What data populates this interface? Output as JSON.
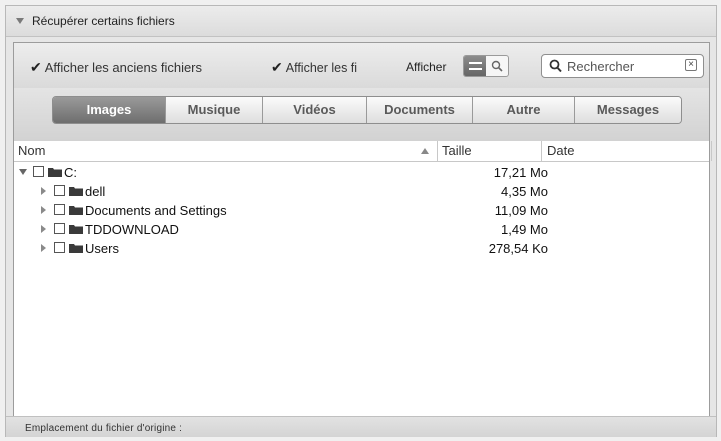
{
  "panel": {
    "title": "Récupérer certains fichiers"
  },
  "toolbar": {
    "show_old_files": {
      "label": "Afficher les anciens fichiers",
      "checked": true
    },
    "show_files_truncated": {
      "label": "Afficher les fi",
      "checked": true
    },
    "display_label": "Afficher",
    "search": {
      "placeholder": "Rechercher"
    }
  },
  "tabs": [
    {
      "label": "Images",
      "active": true
    },
    {
      "label": "Musique",
      "active": false
    },
    {
      "label": "Vidéos",
      "active": false
    },
    {
      "label": "Documents",
      "active": false
    },
    {
      "label": "Autre",
      "active": false
    },
    {
      "label": "Messages",
      "active": false
    }
  ],
  "columns": {
    "name": "Nom",
    "size": "Taille",
    "date": "Date"
  },
  "tree": [
    {
      "name": "C:",
      "size": "17,21 Mo",
      "expanded": true,
      "depth": 0
    },
    {
      "name": "dell",
      "size": "4,35 Mo",
      "expanded": false,
      "depth": 1
    },
    {
      "name": "Documents and Settings",
      "size": "11,09 Mo",
      "expanded": false,
      "depth": 1
    },
    {
      "name": "TDDOWNLOAD",
      "size": "1,49 Mo",
      "expanded": false,
      "depth": 1
    },
    {
      "name": "Users",
      "size": "278,54 Ko",
      "expanded": false,
      "depth": 1
    }
  ],
  "footer": {
    "label": "Emplacement du fichier d'origine :"
  },
  "colors": {
    "active_tab": "#7c7c7c",
    "folder": "#3a3a3a"
  }
}
